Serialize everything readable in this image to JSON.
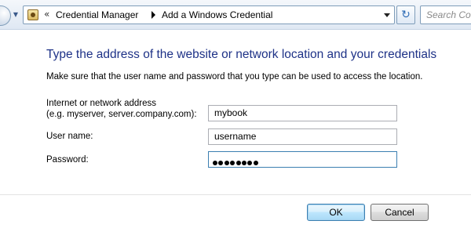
{
  "navbar": {
    "breadcrumb": {
      "overflow_chevron": "«",
      "items": [
        "Credential Manager",
        "Add a Windows Credential"
      ]
    },
    "refresh_icon": "↻",
    "search_placeholder": "Search Co"
  },
  "main": {
    "heading": "Type the address of the website or network location and your credentials",
    "instructions": "Make sure that the user name and password that you type can be used to access the location.",
    "address": {
      "label_line1": "Internet or network address",
      "label_line2": "(e.g. myserver, server.company.com):",
      "value": "mybook"
    },
    "username": {
      "label": "User name:",
      "value": "username"
    },
    "password": {
      "label": "Password:",
      "masked_length": 8
    }
  },
  "buttons": {
    "ok": "OK",
    "cancel": "Cancel"
  },
  "colors": {
    "heading": "#1e3287",
    "focus_border": "#3c7fb1"
  }
}
